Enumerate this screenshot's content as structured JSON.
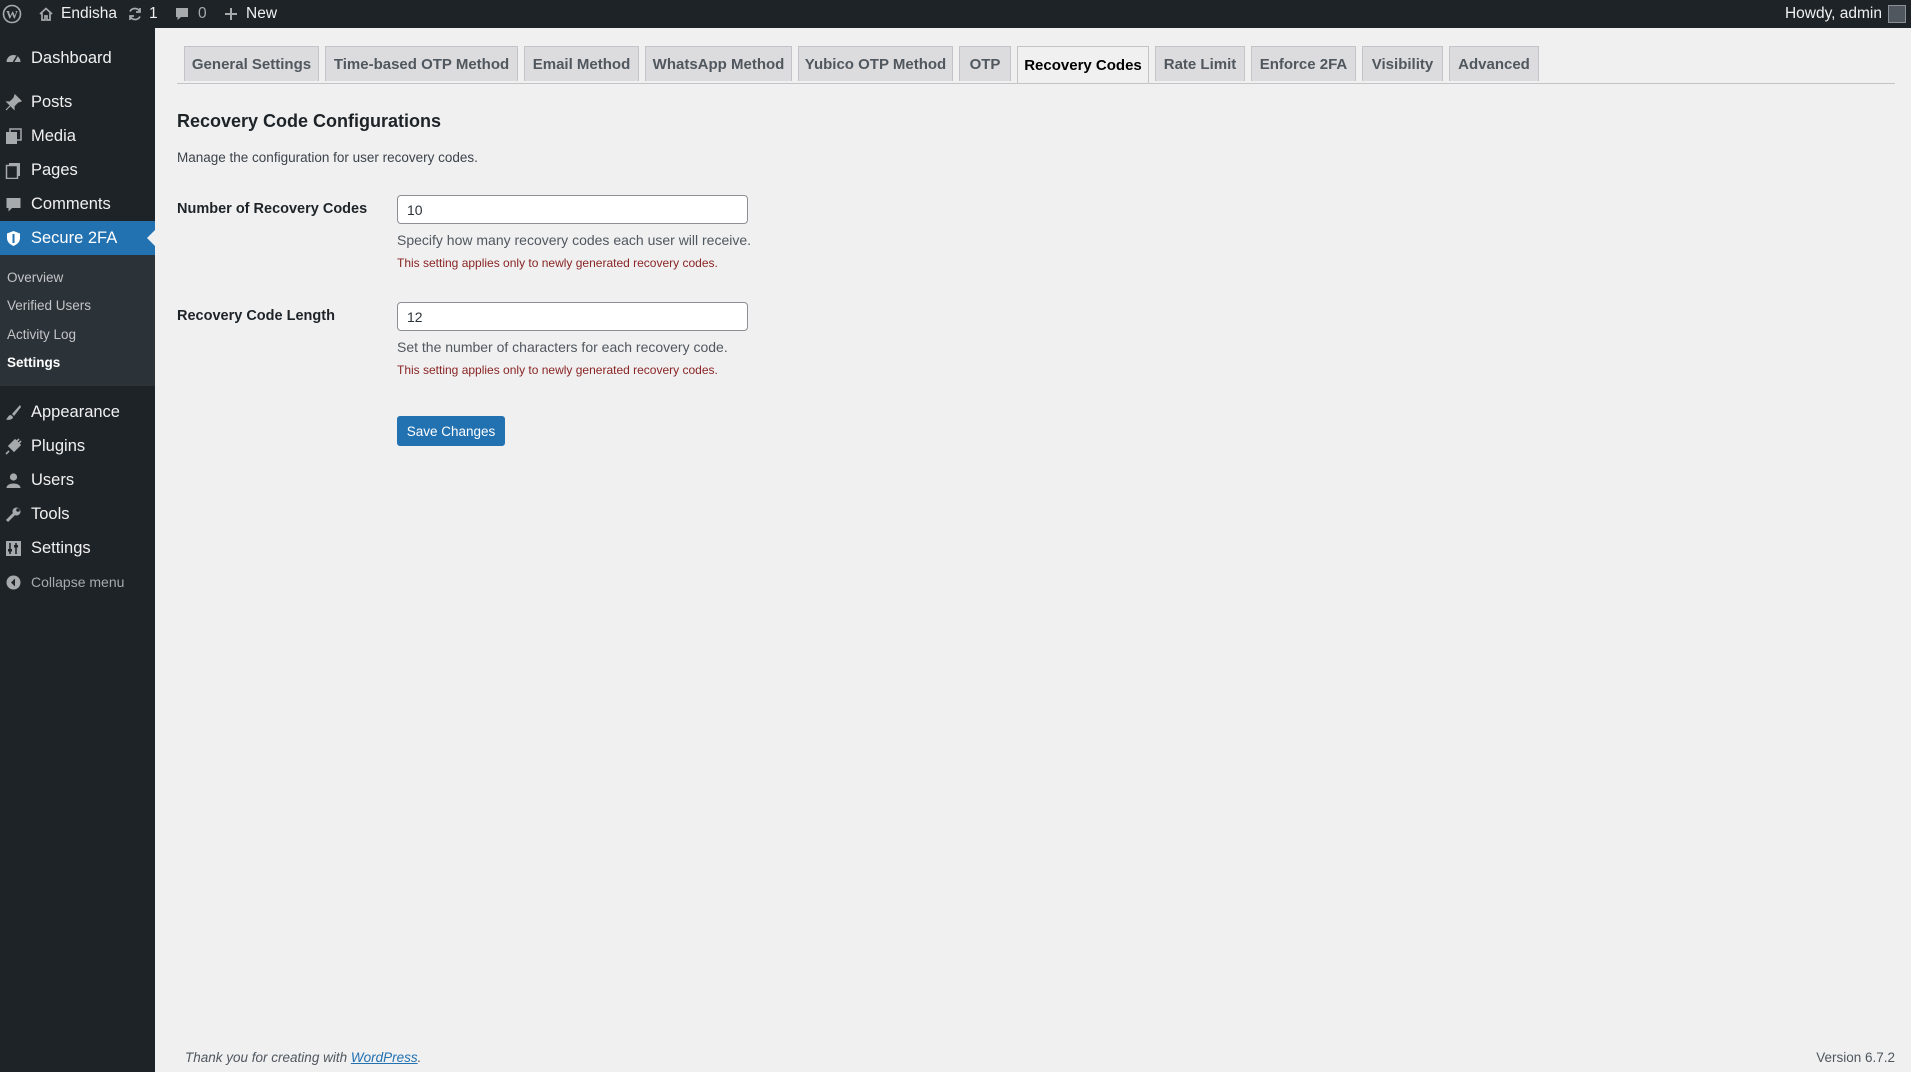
{
  "adminbar": {
    "site_name": "Endisha",
    "updates_count": "1",
    "comments_count": "0",
    "new_label": "New",
    "howdy": "Howdy, admin"
  },
  "sidebar": {
    "items": [
      {
        "label": "Dashboard",
        "icon": "dashboard-icon"
      },
      {
        "label": "Posts",
        "icon": "pin-icon"
      },
      {
        "label": "Media",
        "icon": "media-icon"
      },
      {
        "label": "Pages",
        "icon": "pages-icon"
      },
      {
        "label": "Comments",
        "icon": "comment-icon"
      },
      {
        "label": "Secure 2FA",
        "icon": "shield-icon"
      },
      {
        "label": "Appearance",
        "icon": "paintbrush-icon"
      },
      {
        "label": "Plugins",
        "icon": "plugin-icon"
      },
      {
        "label": "Users",
        "icon": "user-icon"
      },
      {
        "label": "Tools",
        "icon": "wrench-icon"
      },
      {
        "label": "Settings",
        "icon": "settings-icon"
      }
    ],
    "submenu": [
      "Overview",
      "Verified Users",
      "Activity Log",
      "Settings"
    ],
    "collapse_label": "Collapse menu"
  },
  "tabs": [
    "General Settings",
    "Time-based OTP Method",
    "Email Method",
    "WhatsApp Method",
    "Yubico OTP Method",
    "OTP",
    "Recovery Codes",
    "Rate Limit",
    "Enforce 2FA",
    "Visibility",
    "Advanced"
  ],
  "active_tab": "Recovery Codes",
  "section": {
    "title": "Recovery Code Configurations",
    "description": "Manage the configuration for user recovery codes."
  },
  "fields": [
    {
      "label": "Number of Recovery Codes",
      "value": "10",
      "help": "Specify how many recovery codes each user will receive.",
      "warning": "This setting applies only to newly generated recovery codes."
    },
    {
      "label": "Recovery Code Length",
      "value": "12",
      "help": "Set the number of characters for each recovery code.",
      "warning": "This setting applies only to newly generated recovery codes."
    }
  ],
  "save_label": "Save Changes",
  "footer": {
    "thanks_prefix": "Thank you for creating with ",
    "thanks_link": "WordPress",
    "thanks_suffix": ".",
    "version": "Version 6.7.2"
  },
  "colors": {
    "adminbar_bg": "#1d2327",
    "sidebar_bg": "#1d2327",
    "accent": "#2271b1",
    "page_bg": "#f0f0f1",
    "warning_text": "#8a2424"
  }
}
